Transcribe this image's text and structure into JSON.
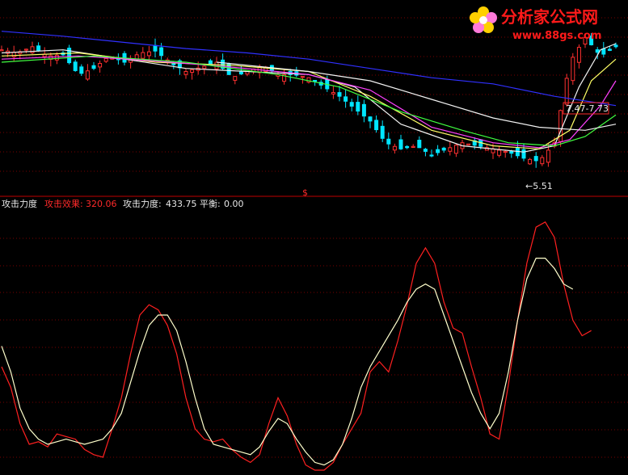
{
  "watermark": {
    "site_name": "分析家公式网",
    "site_url": "www.88gs.com"
  },
  "colors": {
    "background": "#000000",
    "grid": "#7a0000",
    "separator": "#c00000",
    "up_candle": "#ff3030",
    "down_candle": "#00e5ff",
    "ma_white": "#f2f2f2",
    "ma_yellow": "#ffff66",
    "ma_magenta": "#ff40ff",
    "ma_green": "#40ff40",
    "ma_blue": "#3030ff",
    "ind_red": "#ff2020",
    "ind_white": "#ffffcc",
    "label_white": "#e8e8e8",
    "label_red": "#ff2a2a",
    "logo_red": "#ff1a1a",
    "logo_flower": "#ffd000"
  },
  "price_panel": {
    "range_label": "7.47-7.73",
    "low_label": "←5.51",
    "marker_label": "$"
  },
  "indicator_panel": {
    "name": "攻击力度",
    "fields": [
      {
        "label": "攻击效果:",
        "value": "320.06",
        "color": "red"
      },
      {
        "label": "攻击力度:",
        "value": "433.75",
        "color": "white"
      },
      {
        "label": "平衡:",
        "value": "0.00",
        "color": "white"
      }
    ]
  },
  "chart_data": [
    {
      "type": "candlestick",
      "ylim": [
        5.2,
        8.2
      ],
      "grid": true,
      "x": [
        0,
        2,
        4,
        6,
        8,
        10,
        12,
        14,
        16,
        18,
        20,
        22,
        24,
        26,
        28,
        30,
        32,
        34,
        36,
        38,
        40,
        42,
        44,
        46,
        48,
        50,
        52,
        54,
        56,
        58,
        60,
        62,
        64,
        66,
        68,
        70,
        72,
        74,
        76,
        78,
        80,
        82,
        84,
        86,
        88,
        90,
        92,
        94,
        96,
        98,
        100,
        102,
        104,
        106,
        108,
        110,
        112,
        114,
        116,
        118,
        120,
        122,
        124,
        126,
        128,
        130,
        132,
        134,
        136,
        138,
        140,
        142,
        144,
        146,
        148,
        150,
        152,
        154,
        156,
        158,
        160,
        162,
        164,
        166,
        168,
        170,
        172,
        174,
        176,
        178,
        180,
        182,
        184,
        186,
        188,
        190,
        192,
        194,
        196,
        198,
        200
      ],
      "close_points": [
        [
          0,
          7.5
        ],
        [
          5,
          7.45
        ],
        [
          10,
          7.55
        ],
        [
          15,
          7.4
        ],
        [
          20,
          7.42
        ],
        [
          25,
          7.1
        ],
        [
          30,
          7.2
        ],
        [
          35,
          7.4
        ],
        [
          40,
          7.3
        ],
        [
          45,
          7.45
        ],
        [
          50,
          7.48
        ],
        [
          55,
          7.3
        ],
        [
          60,
          7.15
        ],
        [
          65,
          7.22
        ],
        [
          70,
          7.3
        ],
        [
          75,
          7.05
        ],
        [
          80,
          7.15
        ],
        [
          85,
          7.25
        ],
        [
          90,
          7.1
        ],
        [
          95,
          7.1
        ],
        [
          100,
          7.05
        ],
        [
          105,
          6.9
        ],
        [
          110,
          6.75
        ],
        [
          115,
          6.55
        ],
        [
          120,
          6.35
        ],
        [
          125,
          6.0
        ],
        [
          130,
          5.9
        ],
        [
          135,
          5.95
        ],
        [
          140,
          5.8
        ],
        [
          145,
          5.9
        ],
        [
          150,
          6.0
        ],
        [
          155,
          5.95
        ],
        [
          160,
          5.9
        ],
        [
          165,
          5.85
        ],
        [
          170,
          5.75
        ],
        [
          175,
          5.7
        ],
        [
          180,
          6.0
        ],
        [
          185,
          7.3
        ],
        [
          190,
          7.7
        ],
        [
          195,
          7.4
        ],
        [
          200,
          7.55
        ]
      ],
      "moving_averages": [
        {
          "color_key": "ma_white",
          "points": [
            [
              0,
              7.45
            ],
            [
              20,
              7.5
            ],
            [
              40,
              7.35
            ],
            [
              60,
              7.2
            ],
            [
              80,
              7.15
            ],
            [
              100,
              7.1
            ],
            [
              115,
              6.9
            ],
            [
              130,
              6.3
            ],
            [
              150,
              5.95
            ],
            [
              170,
              5.85
            ],
            [
              180,
              5.95
            ],
            [
              188,
              6.9
            ],
            [
              195,
              7.5
            ],
            [
              200,
              7.6
            ]
          ]
        },
        {
          "color_key": "ma_yellow",
          "points": [
            [
              0,
              7.4
            ],
            [
              25,
              7.45
            ],
            [
              50,
              7.3
            ],
            [
              75,
              7.25
            ],
            [
              100,
              7.15
            ],
            [
              120,
              6.75
            ],
            [
              140,
              6.2
            ],
            [
              160,
              5.95
            ],
            [
              175,
              5.9
            ],
            [
              185,
              6.2
            ],
            [
              192,
              7.0
            ],
            [
              200,
              7.35
            ]
          ]
        },
        {
          "color_key": "ma_magenta",
          "points": [
            [
              0,
              7.35
            ],
            [
              25,
              7.4
            ],
            [
              50,
              7.32
            ],
            [
              75,
              7.22
            ],
            [
              100,
              7.1
            ],
            [
              120,
              6.85
            ],
            [
              140,
              6.25
            ],
            [
              160,
              6.0
            ],
            [
              175,
              5.92
            ],
            [
              185,
              6.05
            ],
            [
              195,
              6.6
            ],
            [
              200,
              7.0
            ]
          ]
        },
        {
          "color_key": "ma_green",
          "points": [
            [
              0,
              7.3
            ],
            [
              30,
              7.4
            ],
            [
              60,
              7.3
            ],
            [
              90,
              7.1
            ],
            [
              110,
              6.9
            ],
            [
              130,
              6.5
            ],
            [
              150,
              6.2
            ],
            [
              165,
              6.0
            ],
            [
              180,
              5.95
            ],
            [
              190,
              6.1
            ],
            [
              200,
              6.45
            ]
          ]
        },
        {
          "color_key": "ma_white",
          "points": [
            [
              70,
              7.3
            ],
            [
              100,
              7.15
            ],
            [
              120,
              7.0
            ],
            [
              140,
              6.7
            ],
            [
              160,
              6.4
            ],
            [
              175,
              6.25
            ],
            [
              190,
              6.2
            ],
            [
              200,
              6.3
            ]
          ]
        },
        {
          "color_key": "ma_blue",
          "points": [
            [
              0,
              7.8
            ],
            [
              20,
              7.72
            ],
            [
              40,
              7.62
            ],
            [
              60,
              7.52
            ],
            [
              80,
              7.45
            ],
            [
              100,
              7.35
            ],
            [
              120,
              7.2
            ],
            [
              140,
              7.05
            ],
            [
              160,
              6.95
            ],
            [
              180,
              6.75
            ],
            [
              200,
              6.6
            ]
          ]
        }
      ]
    },
    {
      "type": "line",
      "ylim": [
        0,
        100
      ],
      "grid": true,
      "series": [
        {
          "name": "攻击效果",
          "color_key": "ind_red",
          "values": [
            [
              0,
              40
            ],
            [
              3,
              32
            ],
            [
              6,
              18
            ],
            [
              9,
              10
            ],
            [
              12,
              11
            ],
            [
              15,
              9
            ],
            [
              18,
              14
            ],
            [
              21,
              13
            ],
            [
              24,
              12
            ],
            [
              27,
              8
            ],
            [
              30,
              6
            ],
            [
              33,
              5
            ],
            [
              36,
              16
            ],
            [
              39,
              28
            ],
            [
              42,
              45
            ],
            [
              45,
              60
            ],
            [
              48,
              64
            ],
            [
              51,
              62
            ],
            [
              54,
              56
            ],
            [
              57,
              45
            ],
            [
              60,
              28
            ],
            [
              63,
              16
            ],
            [
              66,
              12
            ],
            [
              69,
              11
            ],
            [
              72,
              12
            ],
            [
              75,
              8
            ],
            [
              78,
              5
            ],
            [
              81,
              3
            ],
            [
              84,
              6
            ],
            [
              87,
              18
            ],
            [
              90,
              28
            ],
            [
              93,
              21
            ],
            [
              96,
              10
            ],
            [
              99,
              2
            ],
            [
              102,
              0
            ],
            [
              105,
              0
            ],
            [
              108,
              3
            ],
            [
              111,
              10
            ],
            [
              114,
              16
            ],
            [
              117,
              22
            ],
            [
              120,
              38
            ],
            [
              123,
              42
            ],
            [
              126,
              38
            ],
            [
              129,
              50
            ],
            [
              132,
              64
            ],
            [
              135,
              80
            ],
            [
              138,
              86
            ],
            [
              141,
              80
            ],
            [
              144,
              65
            ],
            [
              147,
              55
            ],
            [
              150,
              53
            ],
            [
              153,
              40
            ],
            [
              156,
              28
            ],
            [
              159,
              14
            ],
            [
              162,
              12
            ],
            [
              165,
              33
            ],
            [
              168,
              58
            ],
            [
              171,
              80
            ],
            [
              174,
              94
            ],
            [
              177,
              96
            ],
            [
              180,
              90
            ],
            [
              183,
              72
            ],
            [
              186,
              58
            ],
            [
              189,
              52
            ],
            [
              192,
              54
            ]
          ]
        },
        {
          "name": "攻击力度",
          "color_key": "ind_white",
          "values": [
            [
              0,
              48
            ],
            [
              3,
              38
            ],
            [
              6,
              24
            ],
            [
              9,
              16
            ],
            [
              12,
              12
            ],
            [
              15,
              10
            ],
            [
              18,
              11
            ],
            [
              21,
              12
            ],
            [
              24,
              11
            ],
            [
              27,
              10
            ],
            [
              30,
              11
            ],
            [
              33,
              12
            ],
            [
              36,
              16
            ],
            [
              39,
              22
            ],
            [
              42,
              34
            ],
            [
              45,
              46
            ],
            [
              48,
              56
            ],
            [
              51,
              60
            ],
            [
              54,
              60
            ],
            [
              57,
              54
            ],
            [
              60,
              42
            ],
            [
              63,
              28
            ],
            [
              66,
              16
            ],
            [
              69,
              10
            ],
            [
              72,
              9
            ],
            [
              75,
              8
            ],
            [
              78,
              7
            ],
            [
              81,
              6
            ],
            [
              84,
              9
            ],
            [
              87,
              15
            ],
            [
              90,
              20
            ],
            [
              93,
              18
            ],
            [
              96,
              12
            ],
            [
              99,
              7
            ],
            [
              102,
              3
            ],
            [
              105,
              2
            ],
            [
              108,
              4
            ],
            [
              111,
              10
            ],
            [
              114,
              20
            ],
            [
              117,
              32
            ],
            [
              120,
              40
            ],
            [
              123,
              46
            ],
            [
              126,
              52
            ],
            [
              129,
              58
            ],
            [
              132,
              65
            ],
            [
              135,
              70
            ],
            [
              138,
              72
            ],
            [
              141,
              70
            ],
            [
              144,
              60
            ],
            [
              147,
              50
            ],
            [
              150,
              40
            ],
            [
              153,
              30
            ],
            [
              156,
              22
            ],
            [
              159,
              16
            ],
            [
              162,
              22
            ],
            [
              165,
              38
            ],
            [
              168,
              58
            ],
            [
              171,
              74
            ],
            [
              174,
              82
            ],
            [
              177,
              82
            ],
            [
              180,
              78
            ],
            [
              183,
              72
            ],
            [
              186,
              70
            ]
          ]
        }
      ]
    }
  ]
}
